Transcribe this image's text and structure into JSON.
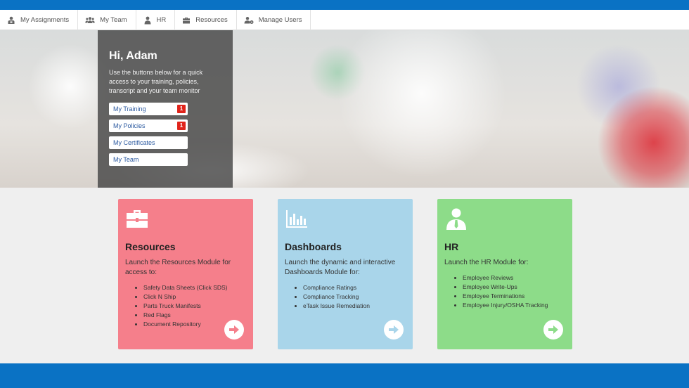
{
  "nav": {
    "items": [
      {
        "label": "My Assignments",
        "icon": "assignments-icon"
      },
      {
        "label": "My Team",
        "icon": "team-icon"
      },
      {
        "label": "HR",
        "icon": "hr-icon"
      },
      {
        "label": "Resources",
        "icon": "briefcase-icon"
      },
      {
        "label": "Manage Users",
        "icon": "manage-users-icon"
      }
    ]
  },
  "hero": {
    "greeting": "Hi, Adam",
    "intro": "Use the buttons below for a quick access to your training, policies, transcript and your team monitor",
    "buttons": [
      {
        "label": "My Training",
        "badge": "1"
      },
      {
        "label": "My Policies",
        "badge": "1"
      },
      {
        "label": "My Certificates"
      },
      {
        "label": "My Team"
      }
    ]
  },
  "cards": [
    {
      "title": "Resources",
      "description": "Launch the Resources Module for access to:",
      "items": [
        "Safety Data Sheets (Click SDS)",
        "Click N Ship",
        "Parts Truck Manifests",
        "Red Flags",
        "Document Repository"
      ],
      "color": "#f57f8b",
      "arrow_color": "#f57f8b",
      "icon": "briefcase-icon"
    },
    {
      "title": "Dashboards",
      "description": "Launch the dynamic and interactive Dashboards Module for:",
      "items": [
        "Compliance Ratings",
        "Compliance Tracking",
        "eTask Issue Remediation"
      ],
      "color": "#a9d5ea",
      "arrow_color": "#a9d5ea",
      "icon": "bar-chart-icon"
    },
    {
      "title": "HR",
      "description": "Launch the HR Module for:",
      "items": [
        "Employee Reviews",
        "Employee Write-Ups",
        "Employee Terminations",
        "Employee Injury/OSHA Tracking"
      ],
      "color": "#8ddc89",
      "arrow_color": "#8ddc89",
      "icon": "user-icon"
    }
  ],
  "colors": {
    "top_bar": "#0a72c4",
    "badge": "#e0241b"
  }
}
